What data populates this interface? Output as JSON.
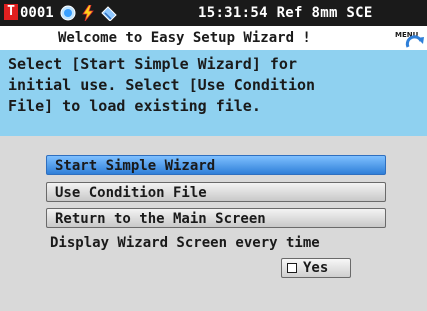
{
  "status_bar": {
    "channel_letter": "T",
    "channel_number": "0001",
    "icons": [
      "target-icon",
      "lightning-icon",
      "probe-icon"
    ],
    "clock": "15:31:54",
    "ref_label": "Ref",
    "aperture": "8mm",
    "mode": "SCE"
  },
  "header": {
    "title": "Welcome to Easy Setup Wizard !",
    "menu_icon": "menu-back-icon",
    "menu_icon_text": "MENU"
  },
  "info": {
    "lines": [
      "Select [Start Simple Wizard] for",
      "initial use. Select [Use Condition",
      "File] to load existing file."
    ]
  },
  "menu": {
    "buttons": [
      {
        "label": "Start Simple Wizard",
        "selected": true
      },
      {
        "label": "Use Condition File",
        "selected": false
      },
      {
        "label": "Return to the Main Screen",
        "selected": false
      }
    ]
  },
  "footer": {
    "note": "Display Wizard Screen every time",
    "yes_label": "Yes",
    "yes_checked": false
  },
  "colors": {
    "status_bar_bg": "#1a1a1a",
    "info_bg": "#8fd1f0",
    "panel_bg": "#d9d9d9",
    "selected_button": "#3f8fe0",
    "channel_badge": "#e02020"
  }
}
